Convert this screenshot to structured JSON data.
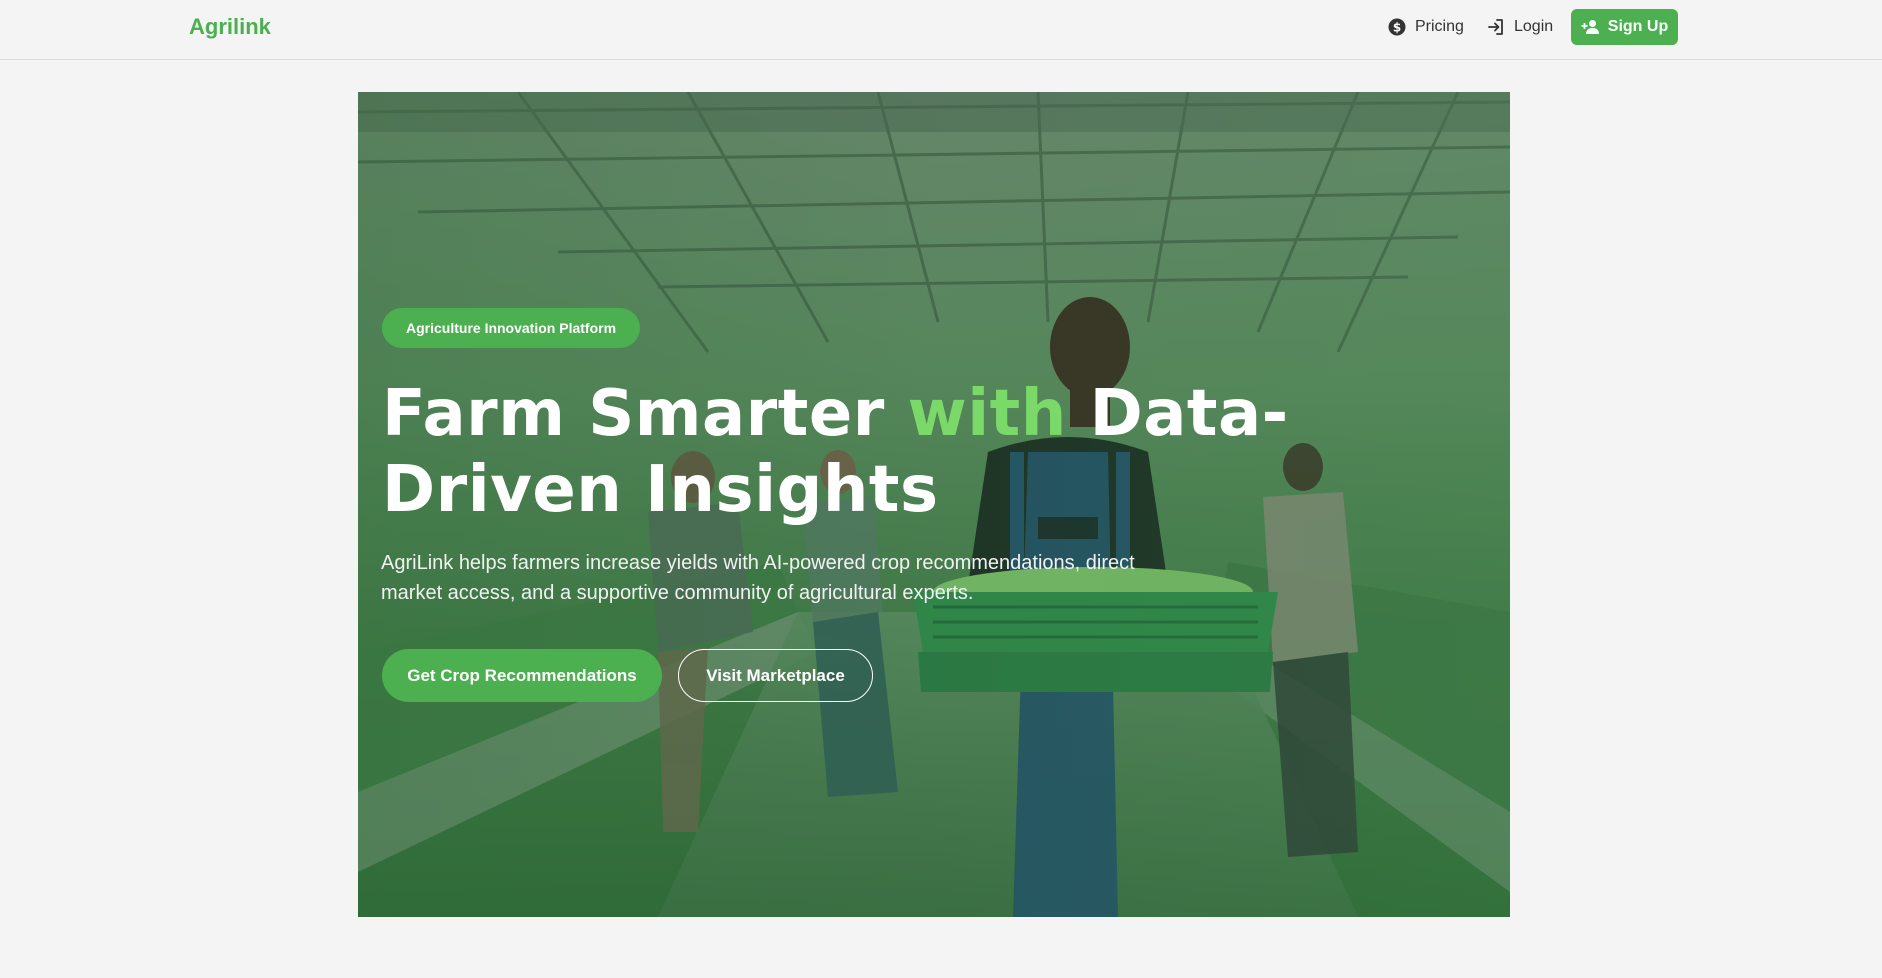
{
  "nav": {
    "brand": "Agrilink",
    "links": [
      {
        "label": "Pricing",
        "icon": "dollar-circle-icon"
      },
      {
        "label": "Login",
        "icon": "login-arrow-icon"
      }
    ],
    "signup": {
      "label": "Sign Up",
      "icon": "person-add-icon"
    }
  },
  "hero": {
    "badge": "Agriculture Innovation Platform",
    "headline_part1": "Farm Smarter ",
    "headline_accent": "with",
    "headline_part2": " Data-Driven Insights",
    "subtitle": "AgriLink helps farmers increase yields with AI-powered crop recommendations, direct market access, and a supportive community of agricultural experts.",
    "primary_cta": "Get Crop Recommendations",
    "secondary_cta": "Visit Marketplace"
  },
  "colors": {
    "brand": "#4caf50",
    "accent_text": "#7bd96a",
    "background": "#f4f4f4"
  }
}
